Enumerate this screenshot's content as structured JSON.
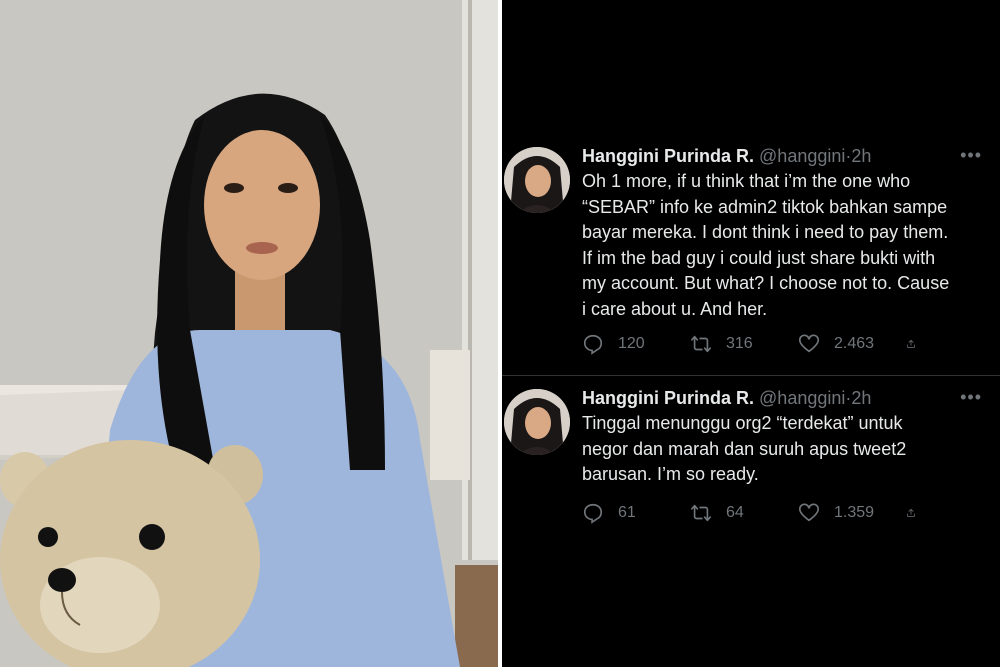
{
  "tweets": [
    {
      "author_name": "Hanggini Purinda R.",
      "handle": "@hanggini",
      "separator": "·",
      "time": "2h",
      "more": "•••",
      "text": "Oh 1 more, if u think that i’m the one who\n“SEBAR” info ke admin2 tiktok bahkan sampe\nbayar mereka. I dont think i need to pay them.\nIf im the bad guy i could just share bukti with\nmy account. But what? I choose not to. Cause\ni care about u. And her.",
      "replies": "120",
      "retweets": "316",
      "likes": "2.463"
    },
    {
      "author_name": "Hanggini Purinda R.",
      "handle": "@hanggini",
      "separator": "·",
      "time": "2h",
      "more": "•••",
      "text": "Tinggal menunggu org2 “terdekat” untuk\nnegor dan marah dan suruh apus tweet2\nbarusan. I’m so ready.",
      "replies": "61",
      "retweets": "64",
      "likes": "1.359"
    }
  ],
  "colors": {
    "background": "#000000",
    "text": "#e7e9ea",
    "secondary": "#71767b",
    "separator": "#2f3336"
  },
  "icons": [
    "reply-icon",
    "retweet-icon",
    "like-icon",
    "share-icon",
    "more-icon"
  ]
}
